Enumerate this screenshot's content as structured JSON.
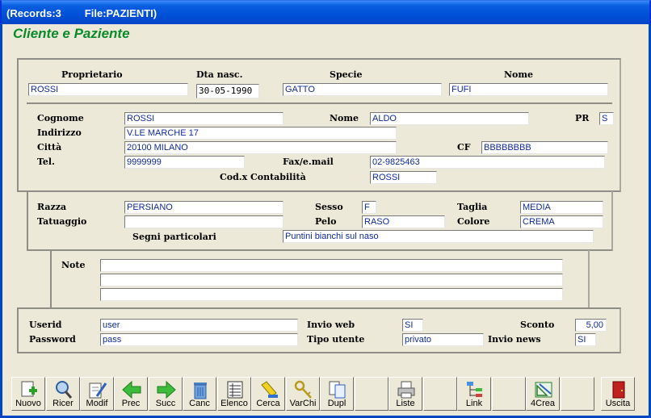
{
  "window": {
    "title": "(Records:3        File:PAZIENTI)"
  },
  "form": {
    "heading": "Cliente e Paziente"
  },
  "owner_header": {
    "proprietario_label": "Proprietario",
    "proprietario": "ROSSI",
    "dta_label": "Dta nasc.",
    "dta": "30-05-1990",
    "specie_label": "Specie",
    "specie": "GATTO",
    "nome_label": "Nome",
    "nome": "FUFI"
  },
  "client": {
    "cognome_label": "Cognome",
    "cognome": "ROSSI",
    "nome_label": "Nome",
    "nome": "ALDO",
    "pr_label": "PR",
    "pr": "S",
    "indirizzo_label": "Indirizzo",
    "indirizzo": "V.LE MARCHE 17",
    "citta_label": "Città",
    "citta": "20100 MILANO",
    "cf_label": "CF",
    "cf": "BBBBBBBB",
    "tel_label": "Tel.",
    "tel": "9999999",
    "fax_label": "Fax/e.mail",
    "fax": "02-9825463",
    "cod_label": "Cod.x Contabilità",
    "cod": "ROSSI"
  },
  "patient": {
    "razza_label": "Razza",
    "razza": "PERSIANO",
    "sesso_label": "Sesso",
    "sesso": "F",
    "taglia_label": "Taglia",
    "taglia": "MEDIA",
    "tatuaggio_label": "Tatuaggio",
    "tatuaggio": "",
    "pelo_label": "Pelo",
    "pelo": "RASO",
    "colore_label": "Colore",
    "colore": "CREMA",
    "segni_label": "Segni particolari",
    "segni": "Puntini bianchi sul naso"
  },
  "notes": {
    "label": "Note",
    "line1": "",
    "line2": "",
    "line3": ""
  },
  "web": {
    "userid_label": "Userid",
    "userid": "user",
    "invio_web_label": "Invio web",
    "invio_web": "SI",
    "sconto_label": "Sconto",
    "sconto": "5,00",
    "password_label": "Password",
    "password": "pass",
    "tipo_label": "Tipo utente",
    "tipo": "privato",
    "news_label": "Invio news",
    "news": "SI"
  },
  "toolbar": {
    "nuovo": "Nuovo",
    "ricer": "Ricer",
    "modif": "Modif",
    "prec": "Prec",
    "succ": "Succ",
    "canc": "Canc",
    "elenco": "Elenco",
    "cerca": "Cerca",
    "varchi": "VarChi",
    "dupl": "Dupl",
    "liste": "Liste",
    "link": "Link",
    "crea": "4Crea",
    "uscita": "Uscita"
  },
  "icons": {
    "nuovo": "new-doc-icon",
    "ricer": "magnifier-icon",
    "modif": "edit-doc-icon",
    "prec": "arrow-left-icon",
    "succ": "arrow-right-icon",
    "canc": "trash-icon",
    "elenco": "list-icon",
    "cerca": "highlighter-icon",
    "varchi": "keys-icon",
    "dupl": "duplicate-icon",
    "liste": "printer-icon",
    "link": "tree-icon",
    "crea": "design-icon",
    "uscita": "exit-door-icon"
  }
}
